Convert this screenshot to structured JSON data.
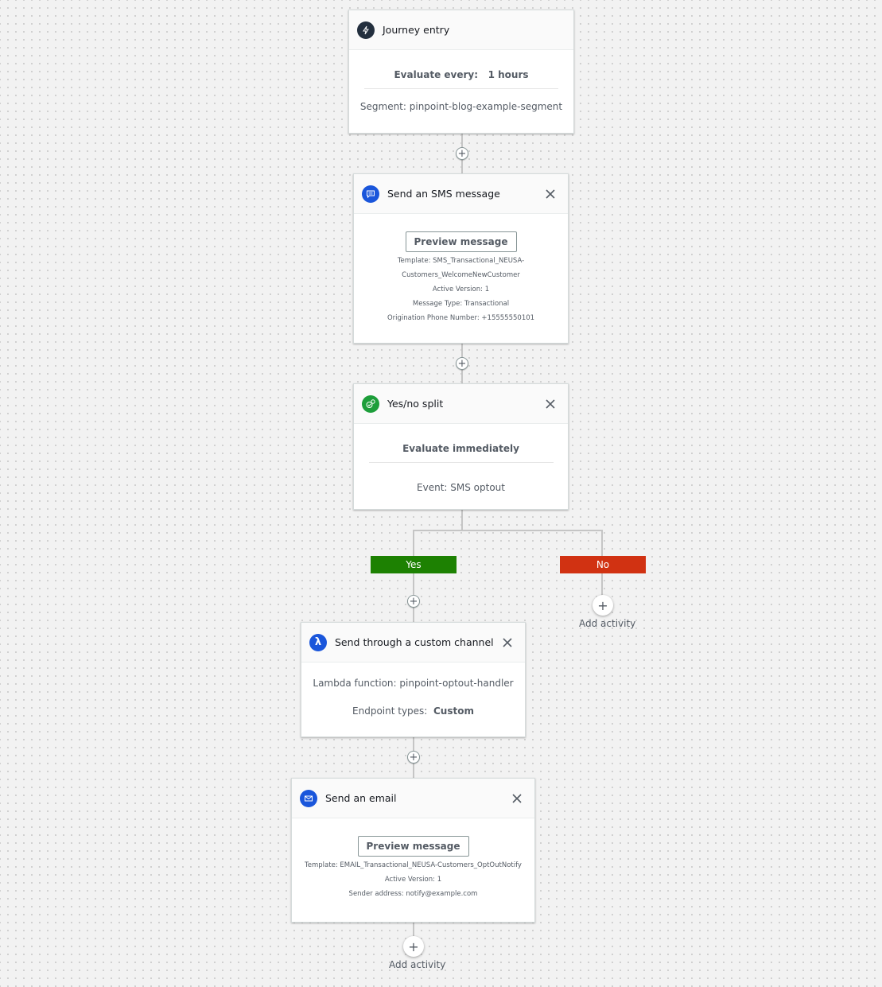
{
  "colors": {
    "yes_branch": "#1d8102",
    "no_branch": "#d13212",
    "entry_icon": "#232f3e",
    "channel_icon": "#1a56db",
    "split_icon": "#1d9e3a"
  },
  "journey_entry": {
    "icon": "lightning-icon",
    "title": "Journey entry",
    "evaluate_label": "Evaluate every:",
    "evaluate_value": "1 hours",
    "segment": "Segment: pinpoint-blog-example-segment"
  },
  "sms_activity": {
    "icon": "chat-bubble-icon",
    "title": "Send an SMS message",
    "preview_label": "Preview message",
    "template_line1": "Template: SMS_Transactional_NEUSA-",
    "template_line2": "Customers_WelcomeNewCustomer",
    "active_version": "Active Version: 1",
    "message_type": "Message Type: Transactional",
    "origination_number": "Origination Phone Number: +15555550101"
  },
  "split_activity": {
    "icon": "split-icon",
    "title": "Yes/no split",
    "evaluate": "Evaluate immediately",
    "event": "Event: SMS optout",
    "yes_label": "Yes",
    "no_label": "No"
  },
  "custom_channel_activity": {
    "icon": "lambda-icon",
    "title": "Send through a custom channel",
    "lambda_function": "Lambda function: pinpoint-optout-handler",
    "endpoint_label": "Endpoint types:",
    "endpoint_value": "Custom"
  },
  "email_activity": {
    "icon": "envelope-icon",
    "title": "Send an email",
    "preview_label": "Preview message",
    "template": "Template: EMAIL_Transactional_NEUSA-Customers_OptOutNotify",
    "active_version": "Active Version: 1",
    "sender_address": "Sender address: notify@example.com"
  },
  "add_activity_label": "Add activity",
  "plus_symbol": "+"
}
